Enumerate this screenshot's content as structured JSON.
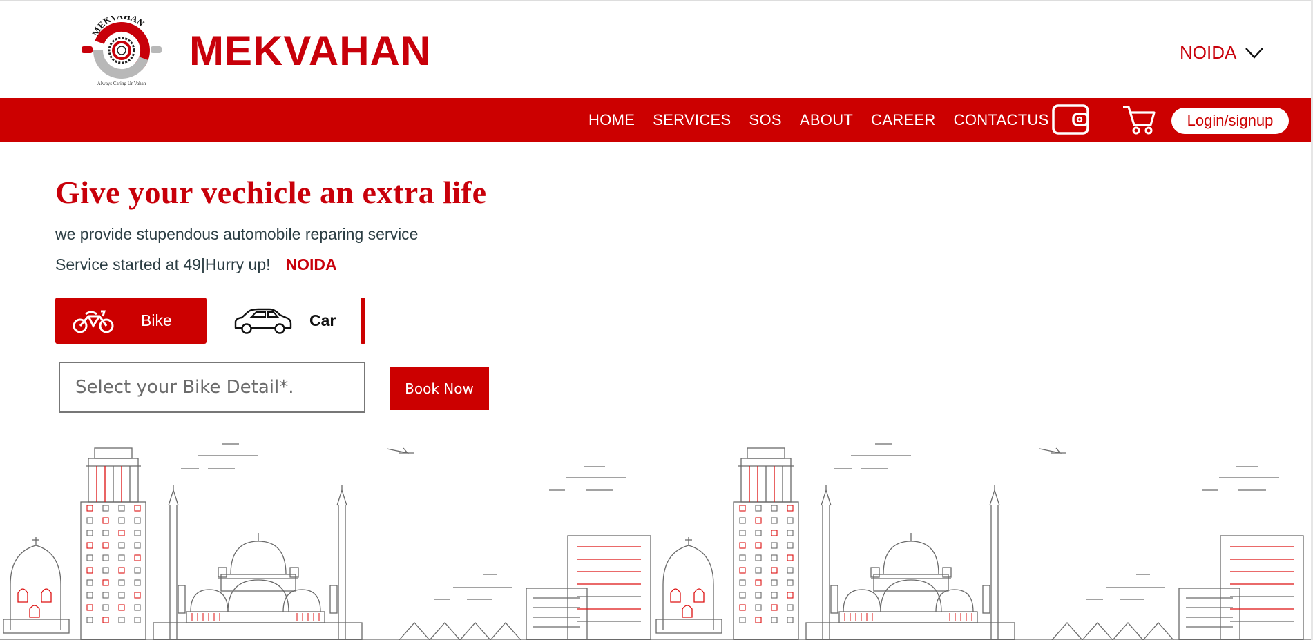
{
  "header": {
    "logo_arc_text": "MEKVAHAN",
    "logo_tagline": "Always Caring Ur Vahan",
    "brand_name": "MEKVAHAN",
    "city": "NOIDA",
    "city_icon": "chevron-down-icon"
  },
  "nav": {
    "items": [
      "HOME",
      "SERVICES",
      "SOS",
      "ABOUT",
      "CAREER",
      "CONTACTUS"
    ],
    "wallet_icon": "wallet-icon",
    "cart_icon": "cart-icon",
    "login_label": "Login/signup"
  },
  "hero": {
    "title": "Give your vechicle an extra life",
    "subtitle": "we provide stupendous automobile reparing service",
    "promo": "Service started at 49|Hurry up!",
    "city": "NOIDA"
  },
  "vehicle_tabs": {
    "bike_label": "Bike",
    "car_label": "Car",
    "selected": "Bike"
  },
  "booking": {
    "placeholder": "Select your Bike Detail*.",
    "button_label": "Book Now"
  },
  "colors": {
    "brand_red": "#cc0000",
    "text_dark": "#2c3e44",
    "white": "#ffffff"
  }
}
